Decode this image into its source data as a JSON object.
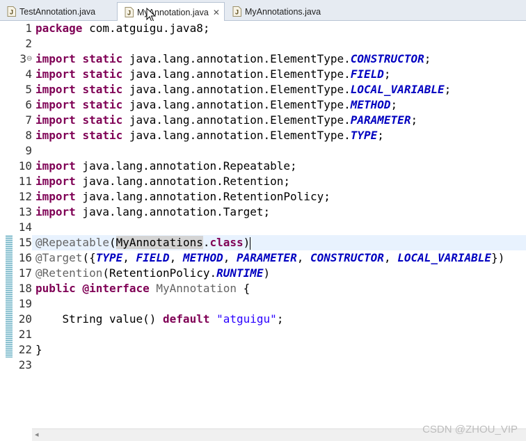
{
  "tabs": [
    {
      "label": "TestAnnotation.java",
      "active": false
    },
    {
      "label": "MyAnnotation.java",
      "active": true,
      "close": "✕"
    },
    {
      "label": "MyAnnotations.java",
      "active": false
    }
  ],
  "line_numbers": [
    "1",
    "2",
    "3",
    "4",
    "5",
    "6",
    "7",
    "8",
    "9",
    "10",
    "11",
    "12",
    "13",
    "14",
    "15",
    "16",
    "17",
    "18",
    "19",
    "20",
    "21",
    "22",
    "23"
  ],
  "code": {
    "l1": {
      "kw": "package",
      "rest": " com.atguigu.java8;"
    },
    "l3": {
      "kw1": "import",
      "kw2": "static",
      "rest": " java.lang.annotation.ElementType.",
      "const": "CONSTRUCTOR",
      "end": ";"
    },
    "l4": {
      "kw1": "import",
      "kw2": "static",
      "rest": " java.lang.annotation.ElementType.",
      "const": "FIELD",
      "end": ";"
    },
    "l5": {
      "kw1": "import",
      "kw2": "static",
      "rest": " java.lang.annotation.ElementType.",
      "const": "LOCAL_VARIABLE",
      "end": ";"
    },
    "l6": {
      "kw1": "import",
      "kw2": "static",
      "rest": " java.lang.annotation.ElementType.",
      "const": "METHOD",
      "end": ";"
    },
    "l7": {
      "kw1": "import",
      "kw2": "static",
      "rest": " java.lang.annotation.ElementType.",
      "const": "PARAMETER",
      "end": ";"
    },
    "l8": {
      "kw1": "import",
      "kw2": "static",
      "rest": " java.lang.annotation.ElementType.",
      "const": "TYPE",
      "end": ";"
    },
    "l10": {
      "kw": "import",
      "rest": " java.lang.annotation.Repeatable;"
    },
    "l11": {
      "kw": "import",
      "rest": " java.lang.annotation.Retention;"
    },
    "l12": {
      "kw": "import",
      "rest": " java.lang.annotation.RetentionPolicy;"
    },
    "l13": {
      "kw": "import",
      "rest": " java.lang.annotation.Target;"
    },
    "l15": {
      "ann": "@Repeatable",
      "open": "(",
      "hl": "MyAnnotations",
      "dot": ".",
      "kw": "class",
      "close": ")"
    },
    "l16": {
      "ann": "@Target",
      "open": "({",
      "c1": "TYPE",
      "c2": "FIELD",
      "c3": "METHOD",
      "c4": "PARAMETER",
      "c5": "CONSTRUCTOR",
      "c6": "LOCAL_VARIABLE",
      "sep": ", ",
      "close": "})"
    },
    "l17": {
      "ann": "@Retention",
      "mid": "(RetentionPolicy.",
      "const": "RUNTIME",
      "close": ")"
    },
    "l18": {
      "kw1": "public",
      "kw2": "@interface",
      "name": " MyAnnotation",
      "brace": " {"
    },
    "l20": {
      "indent": "    ",
      "type": "String value() ",
      "kw": "default",
      "str": "\"atguigu\"",
      "end": ";"
    },
    "l22": {
      "brace": "}"
    }
  },
  "fold_marker": "⊖",
  "watermark": "CSDN @ZHOU_VIP",
  "scroll_arrow": "◂"
}
